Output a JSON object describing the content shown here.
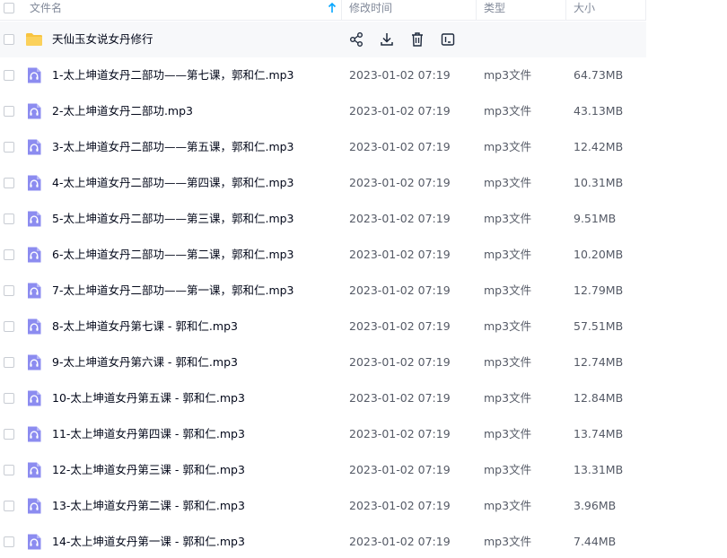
{
  "header": {
    "col_name": "文件名",
    "col_time": "修改时间",
    "col_type": "类型",
    "col_size": "大小"
  },
  "colors": {
    "folder": "#f8c440",
    "audio_icon": "#8c8cf0",
    "text": "#03081a",
    "meta_text": "#555a66",
    "header_text": "#818999",
    "sort_arrow": "#06a7ff"
  },
  "folder_row": {
    "name": "天仙玉女说女丹修行",
    "icon": "folder-icon",
    "actions": [
      "share-icon",
      "download-icon",
      "delete-icon",
      "more-icon"
    ]
  },
  "files": [
    {
      "name": "1-太上坤道女丹二部功——第七课，郭和仁.mp3",
      "time": "2023-01-02 07:19",
      "type": "mp3文件",
      "size": "64.73MB"
    },
    {
      "name": "2-太上坤道女丹二部功.mp3",
      "time": "2023-01-02 07:19",
      "type": "mp3文件",
      "size": "43.13MB"
    },
    {
      "name": "3-太上坤道女丹二部功——第五课，郭和仁.mp3",
      "time": "2023-01-02 07:19",
      "type": "mp3文件",
      "size": "12.42MB"
    },
    {
      "name": "4-太上坤道女丹二部功——第四课，郭和仁.mp3",
      "time": "2023-01-02 07:19",
      "type": "mp3文件",
      "size": "10.31MB"
    },
    {
      "name": "5-太上坤道女丹二部功——第三课，郭和仁.mp3",
      "time": "2023-01-02 07:19",
      "type": "mp3文件",
      "size": "9.51MB"
    },
    {
      "name": "6-太上坤道女丹二部功——第二课，郭和仁.mp3",
      "time": "2023-01-02 07:19",
      "type": "mp3文件",
      "size": "10.20MB"
    },
    {
      "name": "7-太上坤道女丹二部功——第一课，郭和仁.mp3",
      "time": "2023-01-02 07:19",
      "type": "mp3文件",
      "size": "12.79MB"
    },
    {
      "name": "8-太上坤道女丹第七课 - 郭和仁.mp3",
      "time": "2023-01-02 07:19",
      "type": "mp3文件",
      "size": "57.51MB"
    },
    {
      "name": "9-太上坤道女丹第六课 - 郭和仁.mp3",
      "time": "2023-01-02 07:19",
      "type": "mp3文件",
      "size": "12.74MB"
    },
    {
      "name": "10-太上坤道女丹第五课 - 郭和仁.mp3",
      "time": "2023-01-02 07:19",
      "type": "mp3文件",
      "size": "12.84MB"
    },
    {
      "name": "11-太上坤道女丹第四课 - 郭和仁.mp3",
      "time": "2023-01-02 07:19",
      "type": "mp3文件",
      "size": "13.74MB"
    },
    {
      "name": "12-太上坤道女丹第三课 - 郭和仁.mp3",
      "time": "2023-01-02 07:19",
      "type": "mp3文件",
      "size": "13.31MB"
    },
    {
      "name": "13-太上坤道女丹第二课 - 郭和仁.mp3",
      "time": "2023-01-02 07:19",
      "type": "mp3文件",
      "size": "3.96MB"
    },
    {
      "name": "14-太上坤道女丹第一课 - 郭和仁.mp3",
      "time": "2023-01-02 07:19",
      "type": "mp3文件",
      "size": "7.44MB"
    }
  ]
}
